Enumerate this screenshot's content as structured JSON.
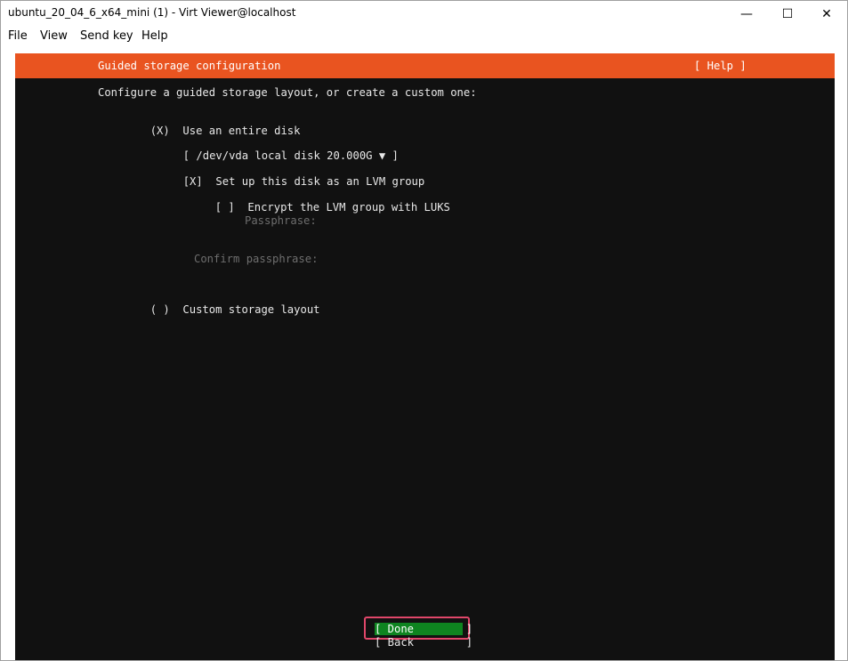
{
  "window": {
    "title": "ubuntu_20_04_6_x64_mini (1) - Virt Viewer@localhost",
    "controls": {
      "minimize": "—",
      "maximize": "☐",
      "close": "✕"
    }
  },
  "menubar": {
    "items": [
      {
        "label": "File"
      },
      {
        "label": "View"
      },
      {
        "label": "Send key"
      },
      {
        "label": "Help"
      }
    ]
  },
  "installer": {
    "header_title": "Guided storage configuration",
    "help_label": "[ Help ]",
    "intro": "Configure a guided storage layout, or create a custom one:",
    "entire_disk": {
      "marker": "(X)",
      "label": "Use an entire disk"
    },
    "disk_select": {
      "open": "[",
      "value": "/dev/vda local disk 20.000G",
      "arrow": "▼",
      "close": "]"
    },
    "lvm": {
      "marker": "[X]",
      "label": "Set up this disk as an LVM group"
    },
    "encrypt": {
      "marker": "[ ]",
      "label": "Encrypt the LVM group with LUKS"
    },
    "passphrase_label": "Passphrase:",
    "confirm_label": "Confirm passphrase:",
    "custom_layout": {
      "marker": "( )",
      "label": "Custom storage layout"
    },
    "done_button": "[ Done        ]",
    "back_button": "[ Back        ]"
  },
  "colors": {
    "header_orange": "#e95420",
    "done_green": "#0e8420",
    "terminal_bg": "#111111",
    "focus_ring": "#e0476a"
  }
}
